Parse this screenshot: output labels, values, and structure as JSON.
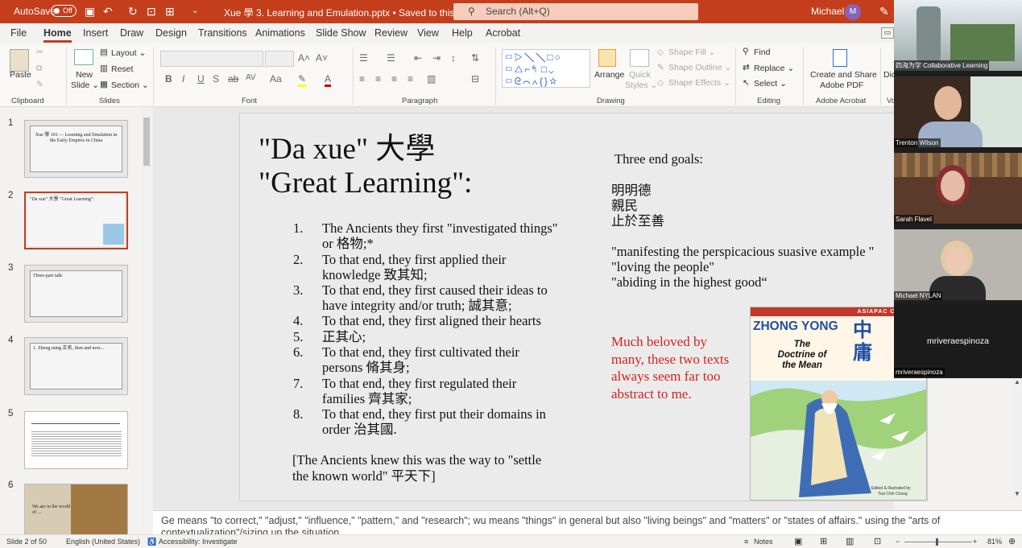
{
  "titlebar": {
    "autosave": "AutoSave",
    "toggle": "Off",
    "doc": "Xue 學 3. Learning and Emulation.pptx • Saved to this PC ⌄",
    "search": "Search (Alt+Q)",
    "user": "Michael",
    "avatar": "M"
  },
  "tabs": [
    "File",
    "Home",
    "Insert",
    "Draw",
    "Design",
    "Transitions",
    "Animations",
    "Slide Show",
    "Review",
    "View",
    "Help",
    "Acrobat"
  ],
  "ribbon": {
    "paste": "Paste",
    "new_slide_1": "New",
    "new_slide_2": "Slide ⌄",
    "layout": "Layout ⌄",
    "reset": "Reset",
    "section": "Section ⌄",
    "arrange": "Arrange",
    "quick_styles_1": "Quick",
    "quick_styles_2": "Styles ⌄",
    "shape_fill": "Shape Fill ⌄",
    "shape_outline": "Shape Outline ⌄",
    "shape_effects": "Shape Effects ⌄",
    "find": "Find",
    "replace": "Replace ⌄",
    "select": "Select ⌄",
    "create_share_1": "Create and Share",
    "create_share_2": "Adobe PDF",
    "dictate": "Dictate",
    "designer": "Designer",
    "vo": "Vo",
    "groups": [
      "Clipboard",
      "Slides",
      "Font",
      "Paragraph",
      "Drawing",
      "Editing",
      "Adobe Acrobat"
    ]
  },
  "thumbs": {
    "items": [
      {
        "num": "1",
        "text": "Xue 學 101 — Learning and Emulation in the Early Empires in China"
      },
      {
        "num": "2",
        "text": "\"Da xue\" 大學 \"Great Learning\":"
      },
      {
        "num": "3",
        "text": "Three-part talk:"
      },
      {
        "num": "4",
        "text": "1. Zheng ming 正名, then and now..."
      },
      {
        "num": "5",
        "text": ""
      },
      {
        "num": "6",
        "text": "We are in the world of ..."
      }
    ]
  },
  "slide": {
    "title1": "\"Da xue\" 大學",
    "title2": "\"Great Learning\":",
    "items": [
      {
        "n": "1.",
        "l1": "The Ancients they first \"investigated things\"",
        "l2": "or 格物;*"
      },
      {
        "n": "2.",
        "l1": "To that end, they first applied their",
        "l2": "knowledge 致其知;"
      },
      {
        "n": "3.",
        "l1": "To that end, they first caused their ideas to",
        "l2": "have integrity and/or truth; 誠其意;"
      },
      {
        "n": "4.",
        "l1": "To that end, they first aligned their hearts",
        "l2": ""
      },
      {
        "n": "5.",
        "l1": " 正其心;",
        "l2": ""
      },
      {
        "n": "6.",
        "l1": "To that end, they first cultivated their",
        "l2": "persons 脩其身;"
      },
      {
        "n": "7.",
        "l1": "To that end, they first regulated their",
        "l2": "families 齊其家;"
      },
      {
        "n": "8.",
        "l1": "To that end, they first put their domains in",
        "l2": "order 治其國."
      }
    ],
    "footer1": "[The Ancients knew this was the way to \"settle",
    "footer2": "the known world\" 平天下]",
    "goals_title": "Three end goals:",
    "goals_cn": [
      "明明德",
      "親民",
      "止於至善"
    ],
    "goals_en": [
      "\"manifesting the perspicacious suasive example \"",
      "\"loving the people\"",
      "\"abiding in the highest good“"
    ],
    "red": [
      "Much beloved by",
      "many, these two texts",
      "always seem far too",
      "abstract to me."
    ],
    "book": {
      "series": "ASIAPAC COMIC SE",
      "title_en": "ZHONG YONG",
      "title_cn": "中庸",
      "sub1": "The",
      "sub2": "Doctrine of",
      "sub3": "the Mean",
      "credit1": "Edited & Illustrated by",
      "credit2": "Tsai Chih Chung"
    }
  },
  "notes": "Ge means \"to correct,\" \"adjust,\" \"influence,\" \"pattern,\" and \"research\"; wu means \"things\" in general but also \"living beings\" and \"matters\" or \"states of affairs.\"  using the \"arts of contextualization\"/sizing up the situation",
  "status": {
    "slide": "Slide 2 of 50",
    "lang": "English (United States)",
    "access": "Accessibility: Investigate",
    "notes": "Notes",
    "zoom": "81%"
  },
  "video": [
    {
      "name": "四海为学 Collaborative Learning"
    },
    {
      "name": "Trenton Wilson"
    },
    {
      "name": "Sarah Flavel"
    },
    {
      "name": "Michael NYLAN"
    },
    {
      "name": "mriveraespinoza",
      "center": "mriveraespinoza"
    }
  ]
}
